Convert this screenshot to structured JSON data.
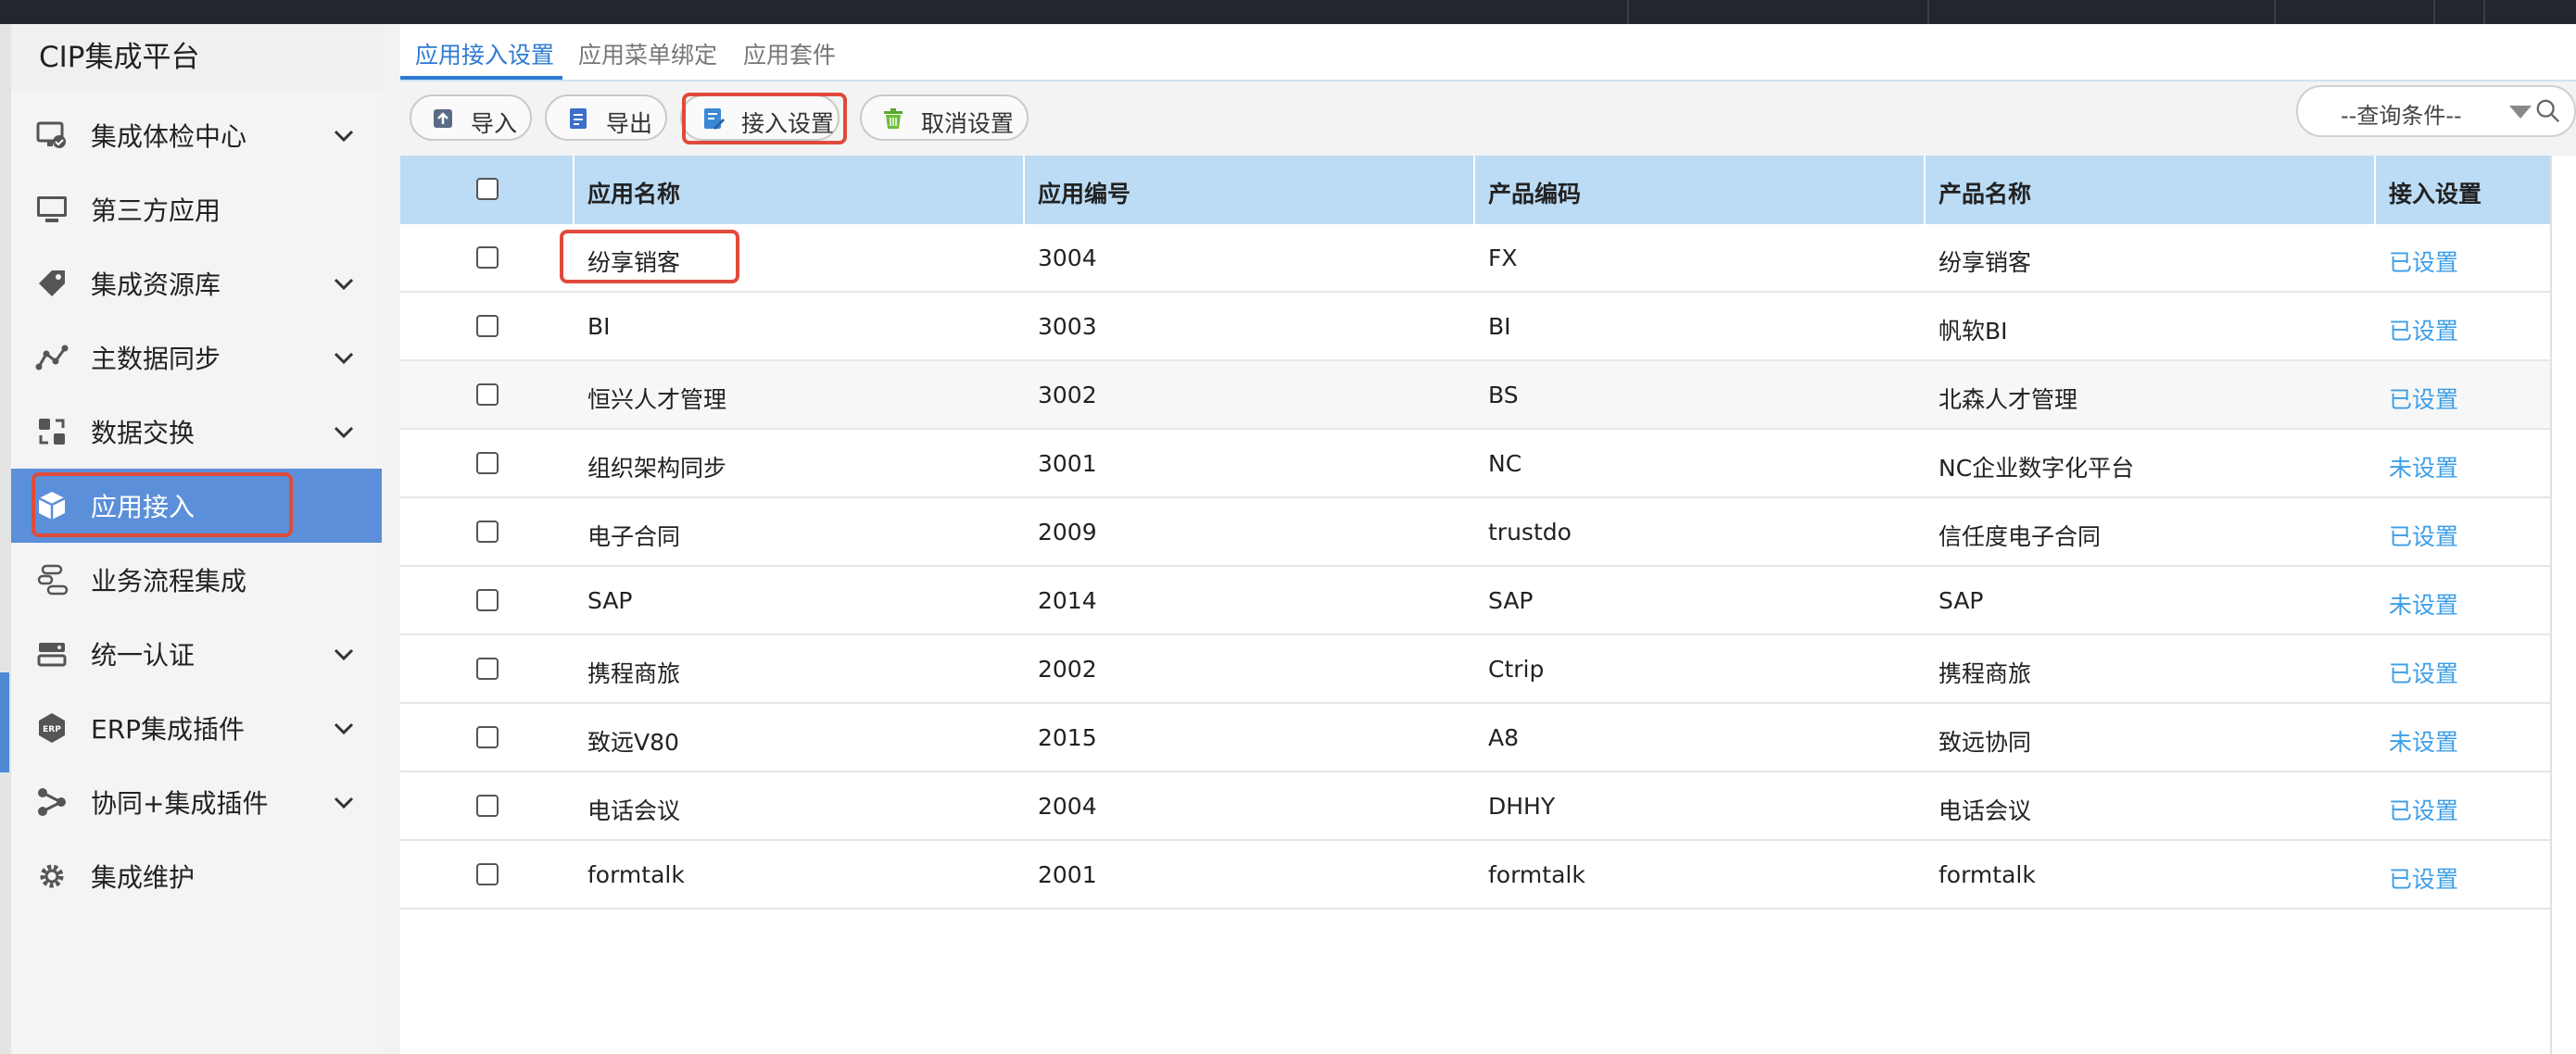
{
  "sidebar": {
    "title": "CIP集成平台",
    "items": [
      {
        "label": "集成体检中心",
        "icon": "monitor-check-icon",
        "expandable": true
      },
      {
        "label": "第三方应用",
        "icon": "desktop-icon",
        "expandable": false
      },
      {
        "label": "集成资源库",
        "icon": "tag-icon",
        "expandable": true
      },
      {
        "label": "主数据同步",
        "icon": "line-chart-icon",
        "expandable": true
      },
      {
        "label": "数据交换",
        "icon": "exchange-icon",
        "expandable": true
      },
      {
        "label": "应用接入",
        "icon": "cube-icon",
        "expandable": false,
        "active": true
      },
      {
        "label": "业务流程集成",
        "icon": "flow-icon",
        "expandable": false
      },
      {
        "label": "统一认证",
        "icon": "server-icon",
        "expandable": true
      },
      {
        "label": "ERP集成插件",
        "icon": "erp-icon",
        "expandable": true
      },
      {
        "label": "协同+集成插件",
        "icon": "share-icon",
        "expandable": true
      },
      {
        "label": "集成维护",
        "icon": "gear-icon",
        "expandable": false
      }
    ]
  },
  "tabs": [
    {
      "label": "应用接入设置",
      "active": true
    },
    {
      "label": "应用菜单绑定",
      "active": false
    },
    {
      "label": "应用套件",
      "active": false
    }
  ],
  "toolbar": {
    "import_label": "导入",
    "export_label": "导出",
    "access_settings_label": "接入设置",
    "cancel_settings_label": "取消设置",
    "query_placeholder": "--查询条件--"
  },
  "table": {
    "headers": [
      "应用名称",
      "应用编号",
      "产品编码",
      "产品名称",
      "接入设置"
    ],
    "rows": [
      {
        "name": "纷享销客",
        "code": "3004",
        "product_code": "FX",
        "product_name": "纷享销客",
        "status": "已设置"
      },
      {
        "name": "BI",
        "code": "3003",
        "product_code": "BI",
        "product_name": "帆软BI",
        "status": "已设置"
      },
      {
        "name": "恒兴人才管理",
        "code": "3002",
        "product_code": "BS",
        "product_name": "北森人才管理",
        "status": "已设置"
      },
      {
        "name": "组织架构同步",
        "code": "3001",
        "product_code": "NC",
        "product_name": "NC企业数字化平台",
        "status": "未设置"
      },
      {
        "name": "电子合同",
        "code": "2009",
        "product_code": "trustdo",
        "product_name": "信任度电子合同",
        "status": "已设置"
      },
      {
        "name": "SAP",
        "code": "2014",
        "product_code": "SAP",
        "product_name": "SAP",
        "status": "未设置"
      },
      {
        "name": "携程商旅",
        "code": "2002",
        "product_code": "Ctrip",
        "product_name": "携程商旅",
        "status": "已设置"
      },
      {
        "name": "致远V80",
        "code": "2015",
        "product_code": "A8",
        "product_name": "致远协同",
        "status": "未设置"
      },
      {
        "name": "电话会议",
        "code": "2004",
        "product_code": "DHHY",
        "product_name": "电话会议",
        "status": "已设置"
      },
      {
        "name": "formtalk",
        "code": "2001",
        "product_code": "formtalk",
        "product_name": "formtalk",
        "status": "已设置"
      }
    ]
  },
  "colors": {
    "accent": "#2e7ad1",
    "active_menu": "#5b8fd9",
    "table_header": "#bcdcf5",
    "link": "#3b9ee8",
    "highlight": "#e04a3a"
  }
}
